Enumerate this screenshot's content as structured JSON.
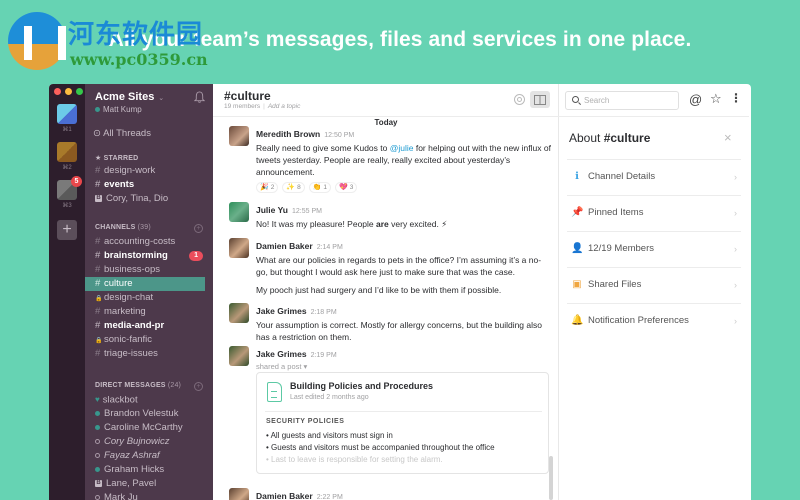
{
  "watermark": {
    "title": "河东软件园",
    "url": "www.pc0359.cn"
  },
  "tagline": "All your team’s messages, files and services in one place.",
  "teams": [
    {
      "key": "⌘1",
      "colors": [
        "#6ccbe8",
        "#4a6fd4"
      ]
    },
    {
      "key": "⌘2",
      "colors": [
        "#a87a2a",
        "#8c5a20"
      ]
    },
    {
      "key": "⌘3",
      "colors": [
        "#7a7a7a",
        "#5a5a5a"
      ],
      "badge": "5"
    }
  ],
  "sidebar": {
    "workspace": "Acme Sites",
    "user": "Matt Kump",
    "all_threads": "All Threads",
    "starred_label": "STARRED",
    "starred": [
      {
        "prefix": "#",
        "label": "design-work",
        "bold": false
      },
      {
        "prefix": "#",
        "label": "events",
        "bold": true
      },
      {
        "prefix": "grp",
        "label": "Cory, Tina, Dio",
        "bold": false
      }
    ],
    "channels_label": "CHANNELS",
    "channels_count": "(39)",
    "channels": [
      {
        "prefix": "#",
        "label": "accounting-costs",
        "bold": false
      },
      {
        "prefix": "#",
        "label": "brainstorming",
        "bold": true,
        "badge": "1"
      },
      {
        "prefix": "#",
        "label": "business-ops",
        "bold": false
      },
      {
        "prefix": "#",
        "label": "culture",
        "active": true
      },
      {
        "prefix": "lock",
        "label": "design-chat",
        "bold": false
      },
      {
        "prefix": "#",
        "label": "marketing",
        "bold": false
      },
      {
        "prefix": "#",
        "label": "media-and-pr",
        "bold": true
      },
      {
        "prefix": "lock",
        "label": "sonic-fanfic",
        "bold": false
      },
      {
        "prefix": "#",
        "label": "triage-issues",
        "bold": false
      }
    ],
    "dm_label": "DIRECT MESSAGES",
    "dm_count": "(24)",
    "dms": [
      {
        "presence": "heart",
        "label": "slackbot"
      },
      {
        "presence": "on",
        "label": "Brandon Velestuk"
      },
      {
        "presence": "on",
        "label": "Caroline McCarthy"
      },
      {
        "presence": "off",
        "label": "Cory Bujnowicz",
        "italic": true
      },
      {
        "presence": "off",
        "label": "Fayaz Ashraf",
        "italic": true
      },
      {
        "presence": "on",
        "label": "Graham Hicks"
      },
      {
        "presence": "grp",
        "label": "Lane, Pavel"
      },
      {
        "presence": "off",
        "label": "Mark Ju"
      }
    ]
  },
  "channel": {
    "title": "#culture",
    "members": "19 members",
    "topic_placeholder": "Add a topic",
    "day_divider": "Today"
  },
  "messages": [
    {
      "name": "Meredith Brown",
      "time": "12:50 PM",
      "text_pre": "Really need to give some Kudos to ",
      "mention": "@julie",
      "text_post": " for helping out with the new influx of tweets yesterday. People are really, really excited about yesterday’s announcement.",
      "reactions": [
        {
          "emoji": "🎉",
          "count": "2"
        },
        {
          "emoji": "✨",
          "count": "8"
        },
        {
          "emoji": "👏",
          "count": "1"
        },
        {
          "emoji": "💖",
          "count": "3"
        }
      ]
    },
    {
      "name": "Julie Yu",
      "time": "12:55 PM",
      "text_pre": "No! It was my pleasure! People ",
      "bold": "are",
      "text_post": " very excited. ⚡"
    },
    {
      "name": "Damien Baker",
      "time": "2:14 PM",
      "text": "What are our policies in regards to pets in the office? I’m assuming it’s a no-go, but thought I would ask here just to make sure that was the case.",
      "text2": "My pooch just had surgery and I’d like to be with them if possible."
    },
    {
      "name": "Jake Grimes",
      "time": "2:18 PM",
      "text": "Your assumption is correct. Mostly for allergy concerns, but the building also has a restriction on them."
    },
    {
      "name": "Jake Grimes",
      "time": "2:19 PM",
      "shared": "shared a post ▾"
    },
    {
      "name": "Damien Baker",
      "time": "2:22 PM"
    }
  ],
  "post": {
    "title": "Building Policies and Procedures",
    "subtitle": "Last edited 2 months ago",
    "section": "SECURITY POLICIES",
    "items": [
      "• All guests and visitors must sign in",
      "• Guests and visitors must be accompanied throughout the office",
      "• Last to leave is responsible for setting the alarm."
    ]
  },
  "right": {
    "search_placeholder": "Search",
    "about_prefix": "About ",
    "about_channel": "#culture",
    "items": [
      {
        "icon": "info-icon",
        "glyph": "ℹ",
        "color": "#3aa3e3",
        "label": "Channel Details"
      },
      {
        "icon": "pin-icon",
        "glyph": "📌",
        "color": "#e57373",
        "label": "Pinned Items"
      },
      {
        "icon": "members-icon",
        "glyph": "👤",
        "color": "#5cb85c",
        "label": "12/19 Members"
      },
      {
        "icon": "files-icon",
        "glyph": "▣",
        "color": "#f0a640",
        "label": "Shared Files"
      },
      {
        "icon": "bell-icon",
        "glyph": "🔔",
        "color": "#e05555",
        "label": "Notification Preferences"
      }
    ]
  }
}
